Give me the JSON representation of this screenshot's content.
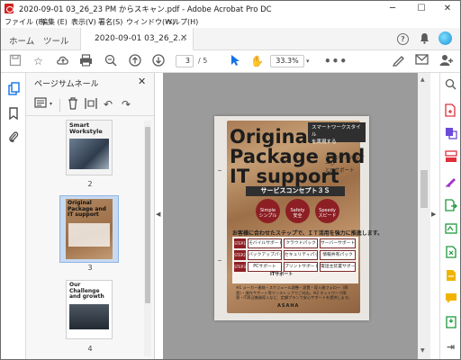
{
  "window": {
    "title": "2020-09-01 03_26_23 PM からスキャン.pdf - Adobe Acrobat Pro DC",
    "controls": {
      "minimize": "─",
      "maximize": "☐",
      "close": "✕"
    }
  },
  "menu": [
    "ファイル (F)",
    "編集 (E)",
    "表示(V)",
    "署名(S)",
    "ウィンドウ(W)",
    "ヘルプ(H)"
  ],
  "tabs": {
    "home": "ホーム",
    "tools": "ツール",
    "document": "2020-09-01 03_26_2..."
  },
  "toolbar": {
    "current_page": "3",
    "total_pages": "/ 5",
    "zoom": "33.3%"
  },
  "thumbnail_panel": {
    "title": "ページサムネール",
    "pages": [
      {
        "number": "2",
        "title_lines": [
          "Smart",
          "Workstyle"
        ]
      },
      {
        "number": "3",
        "title_lines": [
          "Original",
          "Package and",
          "IT support"
        ],
        "selected": true
      },
      {
        "number": "4",
        "title_lines": [
          "Our",
          "Challenge",
          "and growth"
        ]
      }
    ]
  },
  "document": {
    "headline": [
      "Original",
      "Package and",
      "IT support"
    ],
    "header_box": [
      "スマートワークスタイル",
      "を実現する"
    ],
    "sub_lines": [
      "オリジナルパッケージ",
      "とITサポート"
    ],
    "concept_title": "サービスコンセプト３Ｓ",
    "badges": [
      {
        "en": "Simple",
        "jp": "シンプル"
      },
      {
        "en": "Safety",
        "jp": "安全"
      },
      {
        "en": "Speedy",
        "jp": "スピード"
      }
    ],
    "tagline": "お客様に合わせたステップで、ＩＴ活用を強力に推進します。",
    "steps": [
      {
        "label": "STEP1",
        "cells": [
          "モバイルサポート",
          "クラウドパック",
          "サーバーサポート"
        ]
      },
      {
        "label": "STEP2",
        "cells": [
          "バックアップパック",
          "セキュリティパック",
          "情報共有パック"
        ]
      },
      {
        "label": "STEP3",
        "cells": [
          "PCサポート",
          "プリントサポート",
          "電話主装置サポート"
        ]
      }
    ],
    "it_support": "ITサポート",
    "footnote": "※1 メーカー連絡・スケジュール調整・設置・導入後フォロー（障害）・操作サポート等ワンストップでご対応。※2 ネットワーク障害・IT周辺機器導入など、定額プランで安心サポートを提供します。",
    "brand": "ASAHA"
  },
  "colors": {
    "accent_blue": "#1473e6",
    "doc_bg": "#9b9b9b",
    "badge_red": "#8d1f24"
  }
}
